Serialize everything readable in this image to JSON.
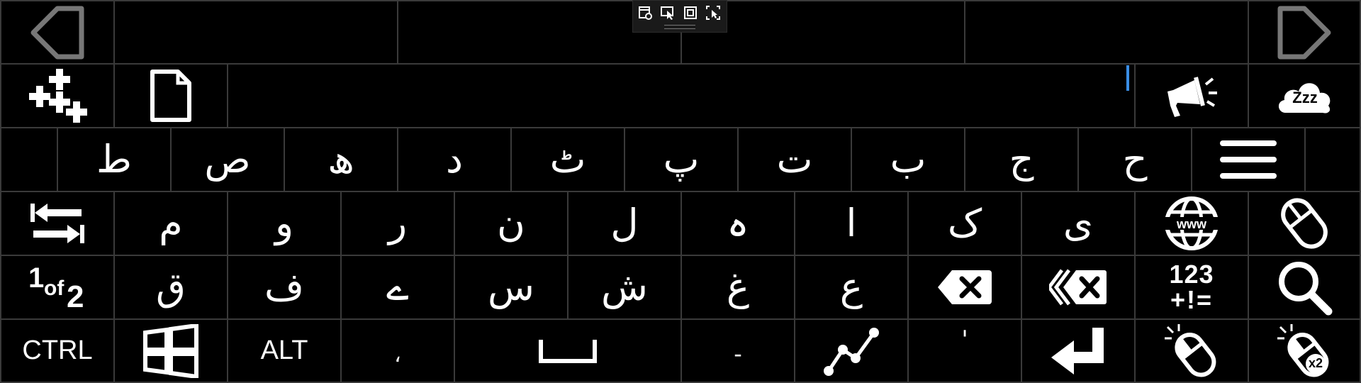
{
  "keyboard": {
    "layout": "Urdu",
    "text_field": {
      "value": ""
    },
    "floating_toolbar": {
      "icons": [
        "settings-window-icon",
        "select-pointer-icon",
        "fit-window-icon",
        "resize-window-icon"
      ]
    },
    "row1": {
      "nav_left_icon": "left-triangle-icon",
      "nav_right_icon": "right-triangle-icon",
      "suggestions": [
        "",
        "",
        "",
        ""
      ]
    },
    "row2": {
      "icons": [
        "quick-add-icon",
        "document-icon",
        "speak-icon",
        "sleep-cloud-icon"
      ],
      "sleep_label": "Zzz"
    },
    "row3": {
      "letters": [
        "ط",
        "ص",
        "ھ",
        "د",
        "ٹ",
        "پ",
        "ت",
        "ب",
        "ج",
        "ح"
      ],
      "menu_icon": "menu-icon"
    },
    "row4": {
      "letters": [
        "م",
        "و",
        "ر",
        "ن",
        "ل",
        "ہ",
        "ا",
        "ک",
        "ی"
      ],
      "icons": [
        "tab-arrows-icon",
        "www-globe-icon",
        "mouse-icon"
      ]
    },
    "row5": {
      "letters": [
        "ق",
        "ف",
        "ے",
        "س",
        "ش",
        "غ",
        "ع"
      ],
      "page_label": {
        "one": "1",
        "of": "of",
        "two": "2"
      },
      "numbers_label": {
        "top": "123",
        "bottom": "+!="
      },
      "icons": [
        "backspace-icon",
        "delete-word-icon",
        "search-icon"
      ]
    },
    "row6": {
      "ctrl": "CTRL",
      "alt": "ALT",
      "comma": "،",
      "dash": "-",
      "apostrophe": "'",
      "x2": "x2",
      "icons": [
        "windows-icon",
        "space-icon",
        "swipe-chart-icon",
        "enter-icon",
        "left-click-icon",
        "double-click-icon"
      ]
    }
  }
}
